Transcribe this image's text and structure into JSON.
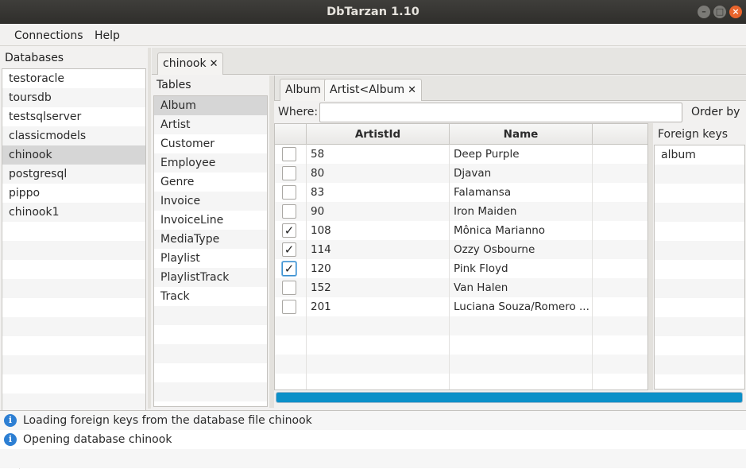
{
  "window": {
    "title": "DbTarzan 1.10",
    "minimize_glyph": "–",
    "maximize_glyph": "□",
    "close_glyph": "×"
  },
  "menubar": {
    "items": [
      "Connections",
      "Help"
    ]
  },
  "databases": {
    "title": "Databases",
    "items": [
      "testoracle",
      "toursdb",
      "testsqlserver",
      "classicmodels",
      "chinook",
      "postgresql",
      "pippo",
      "chinook1"
    ],
    "selected": "chinook"
  },
  "main_tabs": [
    {
      "label": "chinook",
      "close": "✕"
    }
  ],
  "tables": {
    "title": "Tables",
    "items": [
      "Album",
      "Artist",
      "Customer",
      "Employee",
      "Genre",
      "Invoice",
      "InvoiceLine",
      "MediaType",
      "Playlist",
      "PlaylistTrack",
      "Track"
    ],
    "selected": "Album"
  },
  "inner_tabs": [
    {
      "label": "Album",
      "close": ""
    },
    {
      "label": "Artist<Album",
      "close": "✕"
    }
  ],
  "filter": {
    "where_label": "Where:",
    "where_value": "",
    "order_by_label": "Order by"
  },
  "grid": {
    "columns": [
      "",
      "ArtistId",
      "Name"
    ],
    "rows": [
      {
        "checked": false,
        "id": "58",
        "name": "Deep Purple"
      },
      {
        "checked": false,
        "id": "80",
        "name": "Djavan"
      },
      {
        "checked": false,
        "id": "83",
        "name": "Falamansa"
      },
      {
        "checked": false,
        "id": "90",
        "name": "Iron Maiden"
      },
      {
        "checked": true,
        "id": "108",
        "name": "Mônica Marianno"
      },
      {
        "checked": true,
        "id": "114",
        "name": "Ozzy Osbourne"
      },
      {
        "checked": true,
        "id": "120",
        "name": "Pink Floyd"
      },
      {
        "checked": false,
        "id": "152",
        "name": "Van Halen"
      },
      {
        "checked": false,
        "id": "201",
        "name": "Luciana Souza/Romero ..."
      }
    ],
    "check_glyph": "✓"
  },
  "foreign_keys": {
    "title": "Foreign keys",
    "items": [
      "album"
    ]
  },
  "progress": {
    "value": 1.0,
    "color": "#0c90c8"
  },
  "log": {
    "icon": "i",
    "entries": [
      "Loading foreign keys from the database file chinook",
      "Opening database chinook"
    ]
  }
}
